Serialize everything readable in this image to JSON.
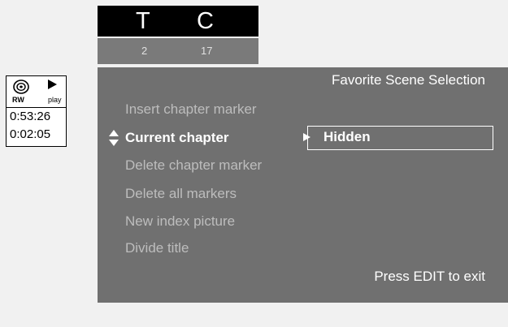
{
  "title_chapter": {
    "title_letter": "T",
    "chapter_letter": "C",
    "title_number": "2",
    "chapter_number": "17"
  },
  "status": {
    "disc_icon": "disc-icon",
    "disc_label": "RW",
    "play_icon": "play-icon",
    "play_label": "play",
    "elapsed_time": "0:53:26",
    "chapter_time": "0:02:05"
  },
  "menu": {
    "title": "Favorite Scene Selection",
    "items": [
      {
        "label": "Insert chapter marker",
        "active": false
      },
      {
        "label": "Current chapter",
        "active": true
      },
      {
        "label": "Delete chapter marker",
        "active": false
      },
      {
        "label": "Delete all markers",
        "active": false
      },
      {
        "label": "New index picture",
        "active": false
      },
      {
        "label": "Divide title",
        "active": false
      }
    ],
    "selected_option": "Hidden",
    "footer": "Press EDIT to exit"
  },
  "colors": {
    "menu_background": "#707070",
    "number_bar": "#7a7a7a",
    "header_background": "#000000",
    "inactive_text": "#bdbdbd",
    "active_text": "#ffffff"
  }
}
